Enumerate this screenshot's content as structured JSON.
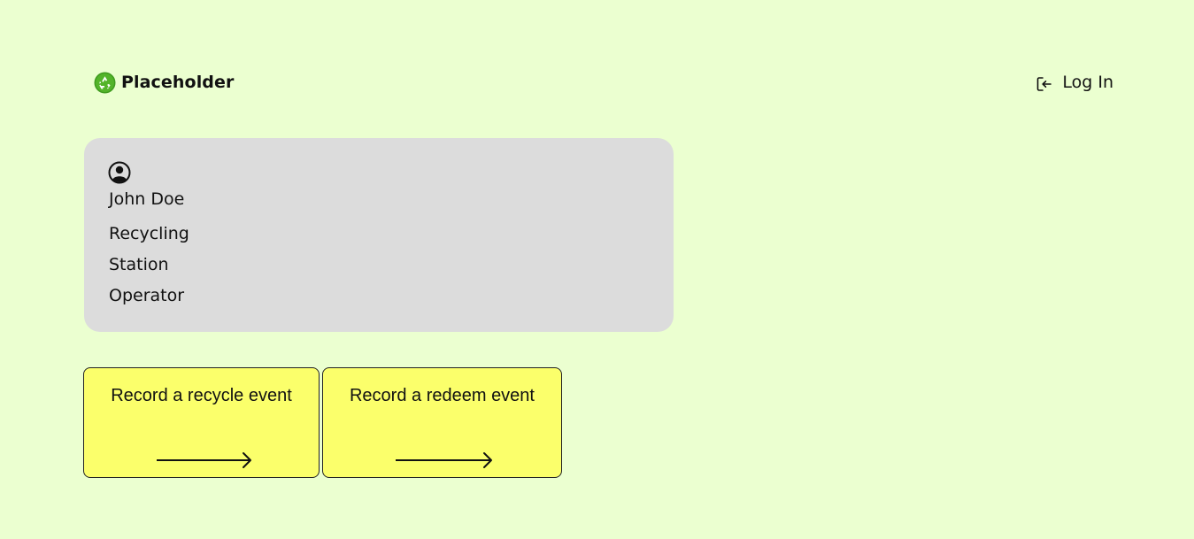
{
  "header": {
    "brand_name": "Placeholder",
    "logo_icon": "recycle-logo-icon",
    "login_icon": "login-icon",
    "login_label": "Log In"
  },
  "profile": {
    "avatar_icon": "user-circle-icon",
    "name": "John Doe",
    "role": "Recycling Station Operator"
  },
  "actions": [
    {
      "label": "Record a recycle event",
      "icon": "arrow-right-icon"
    },
    {
      "label": "Record a redeem event",
      "icon": "arrow-right-icon"
    }
  ],
  "colors": {
    "page_background": "#ebffd0",
    "profile_card_background": "#dcdcdc",
    "action_card_background": "#fbff6b",
    "logo_green": "#3f9b1f",
    "text": "#111111"
  }
}
